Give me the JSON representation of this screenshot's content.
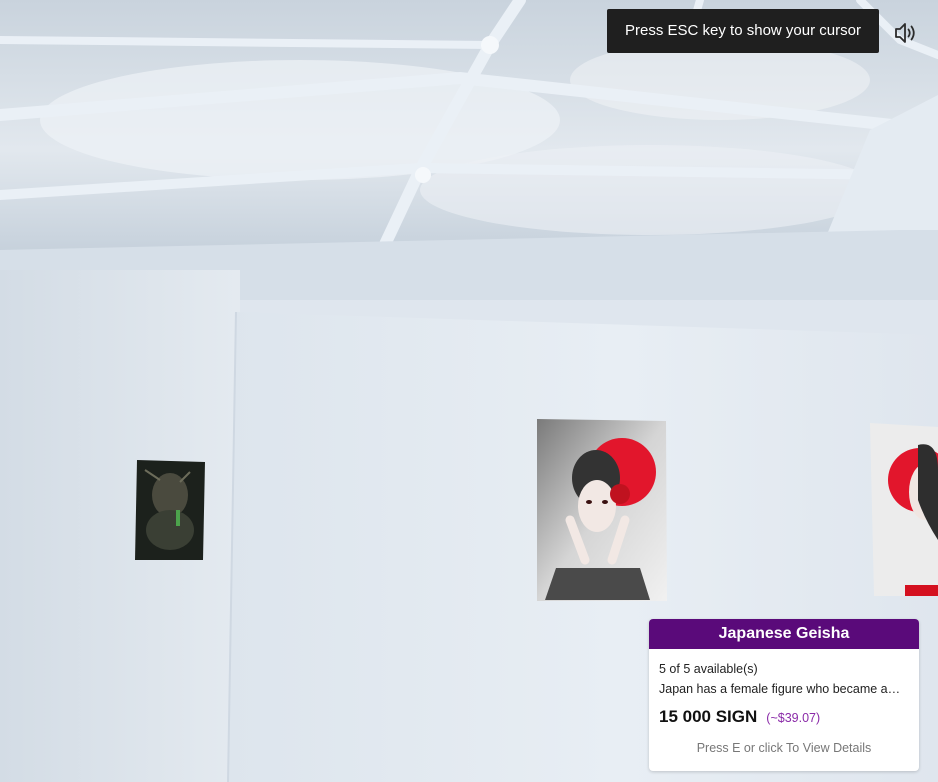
{
  "overlay": {
    "hint": "Press ESC key to show your cursor",
    "sound_icon": "speaker-volume-icon"
  },
  "artwork_card": {
    "title": "Japanese Geisha",
    "availability": "5 of 5 available(s)",
    "description": "Japan has a female figure who became a…",
    "price": "15 000 SIGN",
    "price_usd": "(~$39.07)",
    "cta": "Press E or click To View Details",
    "accent_color": "#5a0a7a",
    "usd_color": "#8a2aa8"
  },
  "scene": {
    "artworks": [
      "dark-fantasy-poster",
      "japanese-geisha-poster",
      "japanese-geisha-poster-partial"
    ]
  }
}
